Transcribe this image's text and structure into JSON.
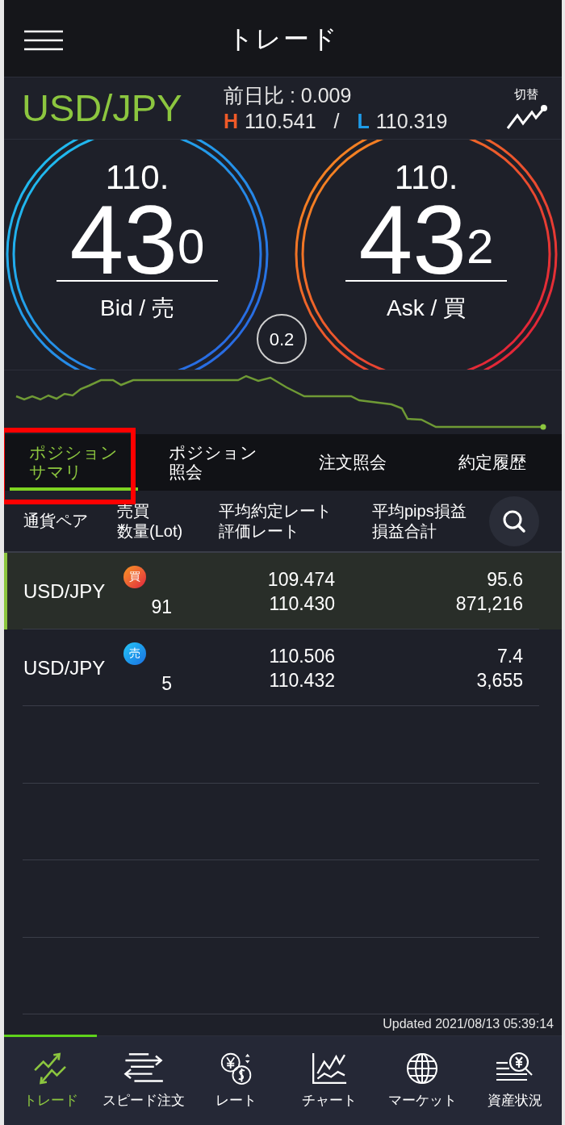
{
  "header": {
    "title": "トレード"
  },
  "quote": {
    "pair": "USD/JPY",
    "change_label": "前日比 : 0.009",
    "high_mark": "H",
    "high": "110.541",
    "separator": "/",
    "low_mark": "L",
    "low": "110.319",
    "switch_label": "切替"
  },
  "prices": [
    {
      "kind": "bid",
      "head": "110.",
      "big": "43",
      "tail": "0",
      "label": "Bid / 売"
    },
    {
      "kind": "ask",
      "head": "110.",
      "big": "43",
      "tail": "2",
      "label": "Ask / 買"
    }
  ],
  "spread": "0.2",
  "tabs": [
    {
      "lines": [
        "ポジション",
        "サマリ"
      ],
      "selected": true,
      "highlighted": true
    },
    {
      "lines": [
        "ポジション",
        "照会"
      ],
      "selected": false,
      "highlighted": false
    },
    {
      "lines": [
        "注文照会"
      ],
      "selected": false,
      "highlighted": false
    },
    {
      "lines": [
        "約定履歴"
      ],
      "selected": false,
      "highlighted": false
    }
  ],
  "table": {
    "columns": [
      [
        "通貨ペア"
      ],
      [
        "売買",
        "数量(Lot)"
      ],
      [
        "平均約定レート",
        "評価レート"
      ],
      [
        "平均pips損益",
        "損益合計"
      ]
    ],
    "rows": [
      {
        "pair": "USD/JPY",
        "kind": "buy",
        "side_label": "買",
        "lots": "91",
        "avg_rate": "109.474",
        "eval_rate": "110.430",
        "pips": "95.6",
        "total": "871,216",
        "selected": true
      },
      {
        "pair": "USD/JPY",
        "kind": "sell",
        "side_label": "売",
        "lots": "5",
        "avg_rate": "110.506",
        "eval_rate": "110.432",
        "pips": "7.4",
        "total": "3,655",
        "selected": false
      }
    ]
  },
  "updated": "Updated  2021/08/13 05:39:14",
  "nav_items": [
    {
      "kind": "trade",
      "label": "トレード",
      "selected": true
    },
    {
      "kind": "speed",
      "label": "スピード注文",
      "selected": false
    },
    {
      "kind": "rate",
      "label": "レート",
      "selected": false
    },
    {
      "kind": "chart",
      "label": "チャート",
      "selected": false
    },
    {
      "kind": "market",
      "label": "マーケット",
      "selected": false
    },
    {
      "kind": "assets",
      "label": "資産状況",
      "selected": false
    }
  ]
}
